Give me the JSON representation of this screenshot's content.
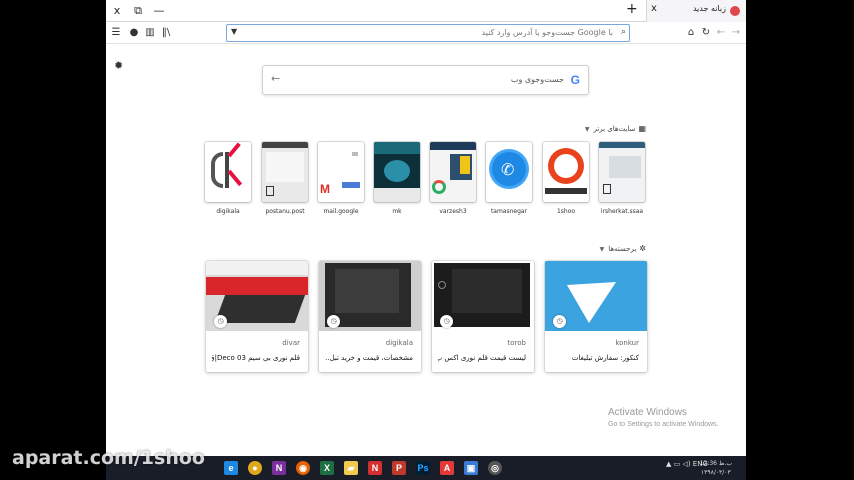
{
  "window": {
    "tab_title": "زبانه جدید",
    "close_glyph": "x",
    "new_tab_glyph": "+",
    "controls": [
      "x",
      "⧉",
      "—"
    ]
  },
  "navbar": {
    "url_placeholder": "با Google جست‌وجو یا آدرس وارد کنید"
  },
  "search": {
    "logo": "G",
    "placeholder": "جست‌وجوی وب"
  },
  "top_sites": {
    "header": "سایت‌های برتر",
    "items": [
      {
        "label": "irsherkat.ssaa"
      },
      {
        "label": "1shoo"
      },
      {
        "label": "tamasnegar"
      },
      {
        "label": "varzesh3"
      },
      {
        "label": "mk"
      },
      {
        "label": "mail.google"
      },
      {
        "label": "postanu.post"
      },
      {
        "label": "digikala"
      }
    ]
  },
  "highlights": {
    "header": "برجسته‌ها",
    "cards": [
      {
        "host": "konkur",
        "title": "کنکور: سفارش تبلیغات"
      },
      {
        "host": "torob",
        "title": "لیست قیمت قلم نوری اکس پ..."
      },
      {
        "host": "digikala",
        "title": "مشخصات، قیمت و خرید تبل..."
      },
      {
        "host": "divar",
        "title": "قلم نوری بی سیم Deco 03|ق..."
      }
    ]
  },
  "activation": {
    "line1": "Activate Windows",
    "line2": "Go to Settings to activate Windows."
  },
  "taskbar": {
    "lang": "ENG",
    "time": "12:36 ب.ظ",
    "date": "۱۳۹۸/۰۳/۰۳"
  },
  "watermark": "aparat.com/1shoo",
  "colors": {
    "telegram": "#3ba4e0",
    "firefox_accent": "#e1484d",
    "taskbar": "#181d28"
  }
}
